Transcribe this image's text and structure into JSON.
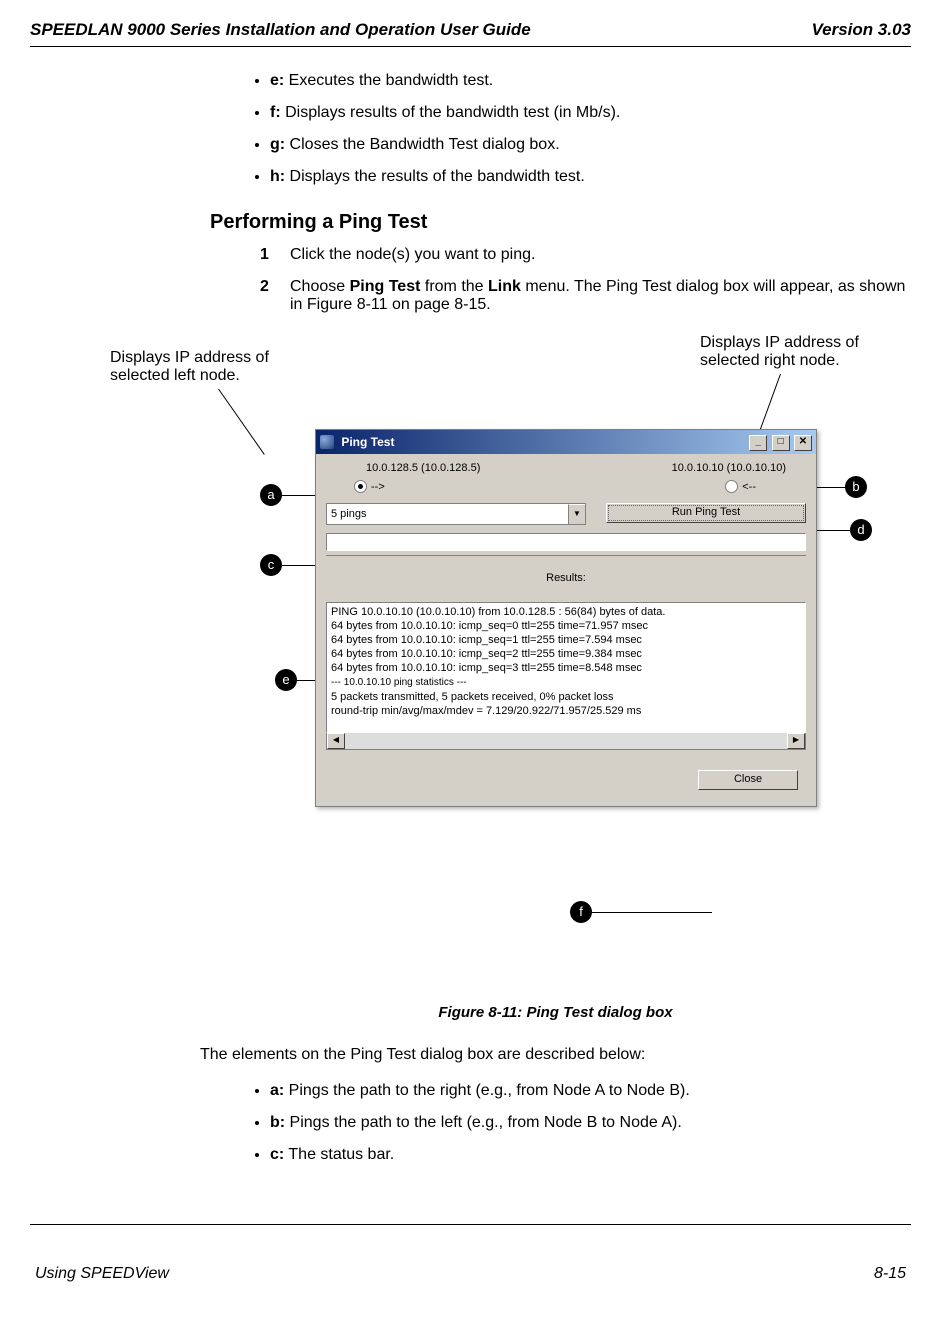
{
  "header": {
    "left": "SPEEDLAN 9000 Series Installation and Operation User Guide",
    "right": "Version 3.03"
  },
  "bullets_top": [
    {
      "key": "e:",
      "text": " Executes the bandwidth test."
    },
    {
      "key": "f:",
      "text": " Displays results of the bandwidth test (in Mb/s)."
    },
    {
      "key": "g:",
      "text": " Closes the Bandwidth Test dialog box."
    },
    {
      "key": "h:",
      "text": " Displays the results of the bandwidth test."
    }
  ],
  "section_title": "Performing a Ping Test",
  "steps": [
    {
      "pre": "Click the node(s) you want to ping."
    },
    {
      "pre": "Choose ",
      "b1": "Ping Test",
      "mid": " from the ",
      "b2": "Link",
      "post": " menu. The Ping Test dialog box will appear, as shown in Figure 8-11 on page 8-15."
    }
  ],
  "annot_left": "Displays IP address of selected left node.",
  "annot_right": "Displays IP address of selected right node.",
  "dialog": {
    "title": "Ping Test",
    "left_addr": "10.0.128.5 (10.0.128.5)",
    "right_addr": "10.0.10.10 (10.0.10.10)",
    "radio_right_arrow": "-->",
    "radio_left_arrow": "<--",
    "combo_value": "5 pings",
    "run_btn": "Run Ping Test",
    "results_label": "Results:",
    "results_lines": [
      "PING 10.0.10.10 (10.0.10.10) from 10.0.128.5 : 56(84) bytes of data.",
      "64 bytes from 10.0.10.10: icmp_seq=0 ttl=255 time=71.957 msec",
      "64 bytes from 10.0.10.10: icmp_seq=1 ttl=255 time=7.594 msec",
      "64 bytes from 10.0.10.10: icmp_seq=2 ttl=255 time=9.384 msec",
      "64 bytes from 10.0.10.10: icmp_seq=3 ttl=255 time=8.548 msec",
      "",
      "--- 10.0.10.10 ping statistics ---",
      "5 packets transmitted, 5 packets received, 0% packet loss",
      "round-trip min/avg/max/mdev = 7.129/20.922/71.957/25.529 ms"
    ],
    "close_btn": "Close",
    "win_min": "_",
    "win_max": "□",
    "win_close": "✕",
    "dd_glyph": "▼",
    "scroll_left": "◀",
    "scroll_right": "▶"
  },
  "callouts": {
    "a": "a",
    "b": "b",
    "c": "c",
    "d": "d",
    "e": "e",
    "f": "f"
  },
  "figure_caption": "Figure 8-11: Ping Test dialog box",
  "para_below": "The elements on the Ping Test dialog box are described below:",
  "bullets_bottom": [
    {
      "key": "a:",
      "text": " Pings the path to the right (e.g., from Node A to Node B)."
    },
    {
      "key": "b:",
      "text": " Pings the path to the left (e.g., from Node B to Node A)."
    },
    {
      "key": "c:",
      "text": " The status bar."
    }
  ],
  "footer": {
    "left": "Using SPEEDView",
    "right": "8-15"
  }
}
